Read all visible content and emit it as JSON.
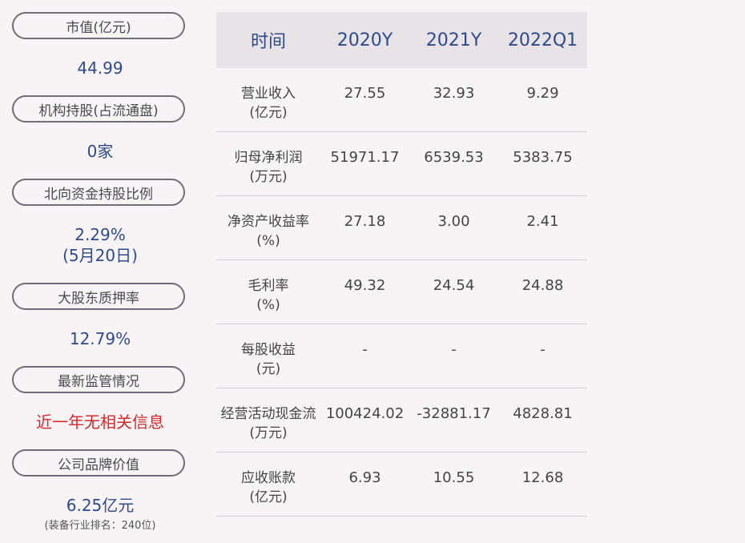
{
  "left": {
    "items": [
      {
        "label": "市值(亿元)",
        "value": "44.99"
      },
      {
        "label": "机构持股(占流通盘)",
        "value": "0家"
      },
      {
        "label": "北向资金持股比例",
        "value": "2.29%",
        "value2": "(5月20日)"
      },
      {
        "label": "大股东质押率",
        "value": "12.79%"
      },
      {
        "label": "最新监管情况",
        "value": "近一年无相关信息"
      },
      {
        "label": "公司品牌价值",
        "value": "6.25亿元",
        "note": "(装备行业排名：240位)"
      }
    ]
  },
  "table": {
    "headers": [
      "时间",
      "2020Y",
      "2021Y",
      "2022Q1"
    ],
    "rows": [
      {
        "label1": "营业收入",
        "label2": "(亿元)",
        "values": [
          "27.55",
          "32.93",
          "9.29"
        ]
      },
      {
        "label1": "归母净利润",
        "label2": "(万元)",
        "values": [
          "51971.17",
          "6539.53",
          "5383.75"
        ]
      },
      {
        "label1": "净资产收益率",
        "label2": "(%)",
        "values": [
          "27.18",
          "3.00",
          "2.41"
        ]
      },
      {
        "label1": "毛利率",
        "label2": "(%)",
        "values": [
          "49.32",
          "24.54",
          "24.88"
        ]
      },
      {
        "label1": "每股收益",
        "label2": "(元)",
        "values": [
          "-",
          "-",
          "-"
        ]
      },
      {
        "label1": "经营活动现金流",
        "label2": "(万元)",
        "values": [
          "100424.02",
          "-32881.17",
          "4828.81"
        ]
      },
      {
        "label1": "应收账款",
        "label2": "(亿元)",
        "values": [
          "6.93",
          "10.55",
          "12.68"
        ]
      }
    ]
  },
  "colors": {
    "accent": "#2e4a8c",
    "alert": "#d12a2a",
    "header_bg": "#e8e3e6"
  }
}
